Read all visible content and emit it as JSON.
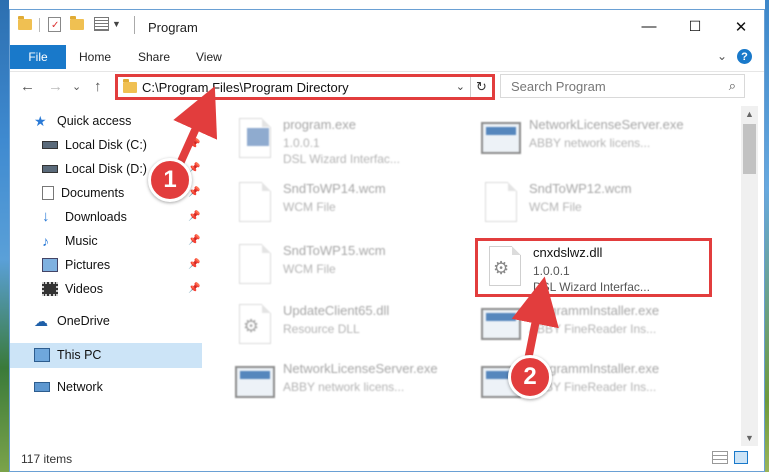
{
  "window": {
    "title": "Program",
    "controls": {
      "minimize": "—",
      "maximize": "☐",
      "close": "✕"
    }
  },
  "ribbon": {
    "tabs": [
      {
        "label": "File",
        "active": true
      },
      {
        "label": "Home"
      },
      {
        "label": "Share"
      },
      {
        "label": "View"
      }
    ],
    "expand_icon": "⌄",
    "help_label": "?"
  },
  "navigation": {
    "back": "←",
    "forward": "→",
    "recent": "⌄",
    "up": "↑",
    "address": "C:\\Program Files\\Program Directory",
    "address_chevron": "⌄",
    "refresh": "↻",
    "search_placeholder": "Search Program",
    "search_icon": "⌕"
  },
  "sidebar": {
    "items": [
      {
        "label": "Quick access",
        "icon": "star-icon",
        "pinned": false
      },
      {
        "label": "Local Disk (C:)",
        "icon": "drive-icon",
        "pinned": true
      },
      {
        "label": "Local Disk (D:)",
        "icon": "drive-icon",
        "pinned": true
      },
      {
        "label": "Documents",
        "icon": "documents-icon",
        "pinned": true
      },
      {
        "label": "Downloads",
        "icon": "download-icon",
        "pinned": true
      },
      {
        "label": "Music",
        "icon": "music-icon",
        "pinned": true
      },
      {
        "label": "Pictures",
        "icon": "pictures-icon",
        "pinned": true
      },
      {
        "label": "Videos",
        "icon": "videos-icon",
        "pinned": true
      },
      {
        "label": "OneDrive",
        "icon": "cloud-icon",
        "pinned": false
      },
      {
        "label": "This PC",
        "icon": "computer-icon",
        "selected": true
      },
      {
        "label": "Network",
        "icon": "network-icon",
        "pinned": false
      }
    ]
  },
  "files": [
    {
      "name": "program.exe",
      "line1": "1.0.0.1",
      "line2": "DSL Wizard Interfac...",
      "icon": "exe-icon"
    },
    {
      "name": "NetworkLicenseServer.exe",
      "line1": "ABBY network licens...",
      "line2": "",
      "icon": "app-window-icon"
    },
    {
      "name": "SndToWP14.wcm",
      "line1": "WCM File",
      "line2": "",
      "icon": "file-icon"
    },
    {
      "name": "SndToWP12.wcm",
      "line1": "WCM File",
      "line2": "",
      "icon": "file-icon"
    },
    {
      "name": "SndToWP15.wcm",
      "line1": "WCM File",
      "line2": "",
      "icon": "file-icon"
    },
    {
      "name": "cnxdslwz.dll",
      "line1": "1.0.0.1",
      "line2": "DSL Wizard Interfac...",
      "icon": "dll-gear-icon",
      "highlighted": true
    },
    {
      "name": "UpdateClient65.dll",
      "line1": "Resource DLL",
      "line2": "",
      "icon": "dll-gear-icon"
    },
    {
      "name": "ProgrammInstaller.exe",
      "line1": "ABBY FineReader Ins...",
      "line2": "",
      "icon": "app-window-icon"
    },
    {
      "name": "NetworkLicenseServer.exe",
      "line1": "ABBY network licens...",
      "line2": "",
      "icon": "app-window-icon"
    },
    {
      "name": "ProgrammInstaller.exe",
      "line1": "ABBY FineReader Ins...",
      "line2": "",
      "icon": "app-window-icon"
    }
  ],
  "status": {
    "item_count": "117 items"
  },
  "callouts": {
    "first": "1",
    "second": "2"
  },
  "colors": {
    "accent": "#1979ca",
    "callout_red": "#e23d3d",
    "selection": "#cce4f7"
  }
}
